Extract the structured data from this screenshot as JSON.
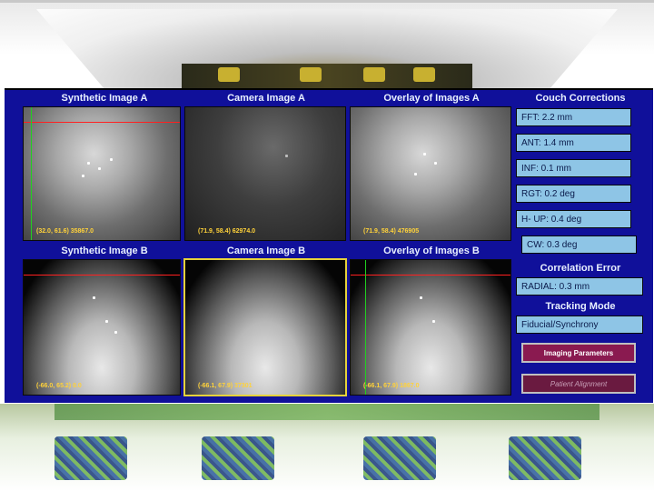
{
  "colors": {
    "app_bg": "#10109a",
    "crosshair_h": "#ff2020",
    "crosshair_v": "#20d020",
    "readout": "#ffd23a",
    "field_bg": "#8ec5e6",
    "button_bg": "#8a1a50",
    "selected_border": "#e6d23a"
  },
  "panels": {
    "synthetic_a": {
      "title": "Synthetic Image A",
      "readout": "(32.0, 61.6) 35867.0"
    },
    "camera_a": {
      "title": "Camera Image A",
      "readout": "(71.9, 58.4) 62974.0"
    },
    "overlay_a": {
      "title": "Overlay of Images A",
      "readout": "(71.9, 58.4) 476905"
    },
    "synthetic_b": {
      "title": "Synthetic Image B",
      "readout": "(-66.0, 65.2) 0.0"
    },
    "camera_b": {
      "title": "Camera Image B",
      "readout": "(-66.1, 67.9) 37301"
    },
    "overlay_b": {
      "title": "Overlay of Images B",
      "readout": "(-66.1, 67.9) 1867.0"
    }
  },
  "couch": {
    "title": "Couch Corrections",
    "fields": [
      "FFT: 2.2 mm",
      "ANT: 1.4 mm",
      "INF: 0.1 mm",
      "RGT: 0.2 deg",
      "H- UP: 0.4 deg",
      "CW: 0.3 deg"
    ]
  },
  "correlation": {
    "title": "Correlation Error",
    "value": "RADIAL: 0.3 mm"
  },
  "tracking": {
    "title": "Tracking Mode",
    "value": "Fiducial/Synchrony"
  },
  "buttons": {
    "imaging": "Imaging Parameters",
    "align": "Patient Alignment"
  }
}
